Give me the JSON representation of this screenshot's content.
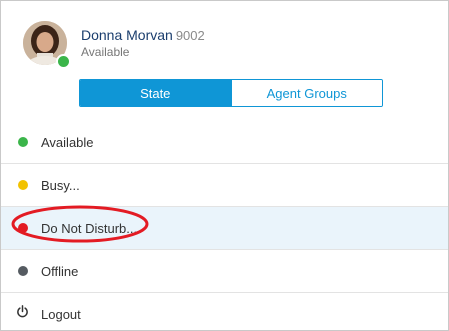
{
  "user": {
    "name": "Donna Morvan",
    "extension": "9002",
    "status": "Available"
  },
  "tabs": [
    {
      "label": "State",
      "active": true
    },
    {
      "label": "Agent Groups",
      "active": false
    }
  ],
  "menu": {
    "items": [
      {
        "label": "Available",
        "color": "#3bb54a",
        "icon": "green-dot-icon"
      },
      {
        "label": "Busy...",
        "color": "#f2c200",
        "icon": "yellow-dot-icon"
      },
      {
        "label": "Do Not Disturb...",
        "color": "#e31b23",
        "icon": "red-dot-icon"
      },
      {
        "label": "Offline",
        "color": "#555b61",
        "icon": "gray-dot-icon"
      }
    ],
    "logout_label": "Logout"
  },
  "colors": {
    "accent": "#0f96d6",
    "name": "#1a3d6d",
    "annotation": "#e31b23"
  }
}
